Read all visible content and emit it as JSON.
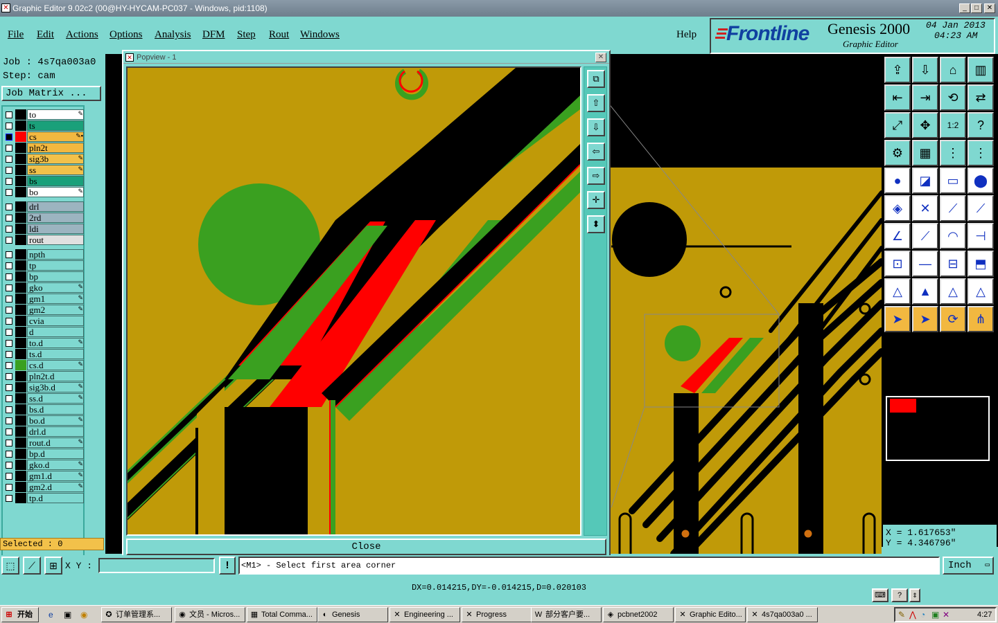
{
  "window": {
    "title": "Graphic Editor 9.02c2 (00@HY-HYCAM-PC037 - Windows, pid:1108)",
    "min_label": "_",
    "max_label": "□",
    "close_label": "✕"
  },
  "menu": {
    "items": [
      "File",
      "Edit",
      "Actions",
      "Options",
      "Analysis",
      "DFM",
      "Step",
      "Rout",
      "Windows"
    ],
    "help": "Help"
  },
  "brand": {
    "logo": "Frontline",
    "product": "Genesis 2000",
    "subtitle": "Graphic Editor",
    "date": "04 Jan 2013",
    "time": "04:23 AM"
  },
  "job": {
    "job_line": "Job : 4s7qa003a0",
    "step_line": "Step: cam",
    "matrix_button": "Job Matrix ..."
  },
  "layers": [
    {
      "name": "to",
      "color": "#ffffff",
      "checked": false,
      "mark": "✎"
    },
    {
      "name": "ts",
      "color": "#1aa07a",
      "checked": false,
      "mark": ""
    },
    {
      "name": "cs",
      "color": "#f2b840",
      "checked": true,
      "mark": "✎▪",
      "swatch": "#ff0000"
    },
    {
      "name": "pln2t",
      "color": "#f2b840",
      "checked": false,
      "mark": ""
    },
    {
      "name": "sig3b",
      "color": "#f2c14a",
      "checked": false,
      "mark": "✎"
    },
    {
      "name": "ss",
      "color": "#f2c14a",
      "checked": false,
      "mark": "✎"
    },
    {
      "name": "bs",
      "color": "#1aa07a",
      "checked": false,
      "mark": ""
    },
    {
      "name": "bo",
      "color": "#ffffff",
      "checked": false,
      "mark": "✎"
    },
    {
      "name": "drl",
      "color": "#9cb4c0",
      "checked": false,
      "mark": "",
      "gap": true
    },
    {
      "name": "2rd",
      "color": "#9cb4c0",
      "checked": false,
      "mark": ""
    },
    {
      "name": "ldi",
      "color": "#9cb4c0",
      "checked": false,
      "mark": ""
    },
    {
      "name": "rout",
      "color": "#e0e0e0",
      "checked": false,
      "mark": ""
    },
    {
      "name": "npth",
      "color": "#7fd8d0",
      "checked": false,
      "mark": "",
      "gap": true
    },
    {
      "name": "tp",
      "color": "#7fd8d0",
      "checked": false,
      "mark": ""
    },
    {
      "name": "bp",
      "color": "#7fd8d0",
      "checked": false,
      "mark": ""
    },
    {
      "name": "gko",
      "color": "#7fd8d0",
      "checked": false,
      "mark": "✎"
    },
    {
      "name": "gm1",
      "color": "#7fd8d0",
      "checked": false,
      "mark": "✎"
    },
    {
      "name": "gm2",
      "color": "#7fd8d0",
      "checked": false,
      "mark": "✎"
    },
    {
      "name": "cvia",
      "color": "#7fd8d0",
      "checked": false,
      "mark": ""
    },
    {
      "name": "d",
      "color": "#7fd8d0",
      "checked": false,
      "mark": ""
    },
    {
      "name": "to.d",
      "color": "#7fd8d0",
      "checked": false,
      "mark": "✎"
    },
    {
      "name": "ts.d",
      "color": "#7fd8d0",
      "checked": false,
      "mark": ""
    },
    {
      "name": "cs.d",
      "color": "#7fd8d0",
      "checked": false,
      "mark": "✎",
      "swatch": "#3aa020"
    },
    {
      "name": "pln2t.d",
      "color": "#7fd8d0",
      "checked": false,
      "mark": ""
    },
    {
      "name": "sig3b.d",
      "color": "#7fd8d0",
      "checked": false,
      "mark": "✎"
    },
    {
      "name": "ss.d",
      "color": "#7fd8d0",
      "checked": false,
      "mark": "✎"
    },
    {
      "name": "bs.d",
      "color": "#7fd8d0",
      "checked": false,
      "mark": ""
    },
    {
      "name": "bo.d",
      "color": "#7fd8d0",
      "checked": false,
      "mark": "✎"
    },
    {
      "name": "drl.d",
      "color": "#7fd8d0",
      "checked": false,
      "mark": ""
    },
    {
      "name": "rout.d",
      "color": "#7fd8d0",
      "checked": false,
      "mark": "✎"
    },
    {
      "name": "bp.d",
      "color": "#7fd8d0",
      "checked": false,
      "mark": ""
    },
    {
      "name": "gko.d",
      "color": "#7fd8d0",
      "checked": false,
      "mark": "✎"
    },
    {
      "name": "gm1.d",
      "color": "#7fd8d0",
      "checked": false,
      "mark": "✎"
    },
    {
      "name": "gm2.d",
      "color": "#7fd8d0",
      "checked": false,
      "mark": "✎"
    },
    {
      "name": "tp.d",
      "color": "#7fd8d0",
      "checked": false,
      "mark": ""
    }
  ],
  "selected": "Selected : 0",
  "popview": {
    "title": "Popview - 1",
    "close_label": "Close"
  },
  "coords": {
    "x": "X = 1.617653\"",
    "y": "Y = 4.346796\""
  },
  "status": {
    "xy_label": "X Y :",
    "xy_value": "",
    "prompt": "<M1> - Select first area corner",
    "unit": "Inch",
    "measure": "DX=0.014215,DY=-0.014215,D=0.020103"
  },
  "taskbar": {
    "start": "开始",
    "tasks": [
      "订单管理系...",
      "文员 - Micros...",
      "Total Comma...",
      "Genesis",
      "Engineering ...",
      "Progress",
      "部分客户要...",
      "pcbnet2002",
      "Graphic Edito...",
      "4s7qa003a0 ..."
    ],
    "clock": "4:27"
  },
  "colors": {
    "panel": "#7fd8d0",
    "copper": "#c09a08",
    "signal_red": "#ff0000",
    "green_layer": "#3aa020"
  }
}
